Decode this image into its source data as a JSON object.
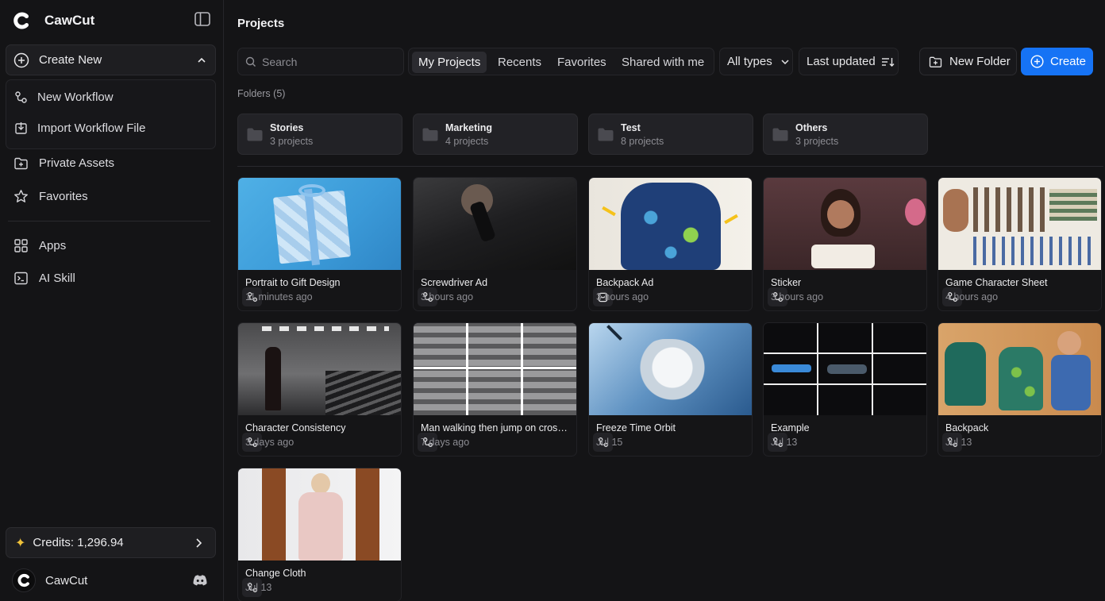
{
  "app": {
    "name": "CawCut"
  },
  "sidebar": {
    "create_new": "Create New",
    "dropdown": [
      {
        "label": "New Workflow",
        "icon": "workflow-icon"
      },
      {
        "label": "Import Workflow File",
        "icon": "import-icon"
      }
    ],
    "nav": [
      {
        "label": "Private Assets",
        "icon": "folder-lock-icon"
      },
      {
        "label": "Favorites",
        "icon": "star-icon"
      },
      {
        "label": "Apps",
        "icon": "grid-icon"
      },
      {
        "label": "AI Skill",
        "icon": "terminal-icon"
      }
    ],
    "credits": "Credits: 1,296.94",
    "user": "CawCut"
  },
  "main": {
    "title": "Projects",
    "search_placeholder": "Search",
    "tabs": [
      "My Projects",
      "Recents",
      "Favorites",
      "Shared with me"
    ],
    "active_tab": "My Projects",
    "type_filter": "All types",
    "sort": "Last updated",
    "new_folder": "New Folder",
    "create": "Create",
    "folders_label": "Folders (5)",
    "folders": [
      {
        "name": "Stories",
        "count": "3 projects"
      },
      {
        "name": "Marketing",
        "count": "4 projects"
      },
      {
        "name": "Test",
        "count": "8 projects"
      },
      {
        "name": "Others",
        "count": "3 projects"
      }
    ],
    "projects": [
      {
        "title": "Portrait to Gift Design",
        "time": "11 minutes ago",
        "badge": "workflow-icon"
      },
      {
        "title": "Screwdriver Ad",
        "time": "3 hours ago",
        "badge": "workflow-icon"
      },
      {
        "title": "Backpack Ad",
        "time": "3 hours ago",
        "badge": "board-icon"
      },
      {
        "title": "Sticker",
        "time": "3 hours ago",
        "badge": "workflow-icon"
      },
      {
        "title": "Game Character Sheet",
        "time": "4 hours ago",
        "badge": "workflow-icon"
      },
      {
        "title": "Character Consistency",
        "time": "3 days ago",
        "badge": "workflow-icon"
      },
      {
        "title": "Man walking then jump on crossing road",
        "time": "7 days ago",
        "badge": "workflow-icon"
      },
      {
        "title": "Freeze Time Orbit",
        "time": "Jul 15",
        "badge": "workflow-icon"
      },
      {
        "title": "Example",
        "time": "Jul 13",
        "badge": "workflow-icon"
      },
      {
        "title": "Backpack",
        "time": "Jul 13",
        "badge": "workflow-icon"
      },
      {
        "title": "Change Cloth",
        "time": "Jul 13",
        "badge": "workflow-icon"
      }
    ]
  },
  "colors": {
    "accent": "#1673f5",
    "background": "#141416",
    "credits_star": "#f0c23a"
  }
}
